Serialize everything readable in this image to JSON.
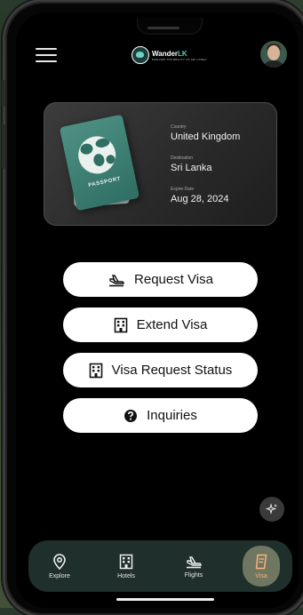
{
  "header": {
    "logo": {
      "name": "WanderLK",
      "name_a": "Wander",
      "name_b": "LK",
      "tagline": "EXPLORE THE BEAUTY OF SRI LANKA"
    }
  },
  "passport_card": {
    "cover_text": "PASSPORT",
    "fields": [
      {
        "label": "Country",
        "value": "United Kingdom"
      },
      {
        "label": "Destination",
        "value": "Sri Lanka"
      },
      {
        "label": "Expire Date",
        "value": "Aug 28, 2024"
      }
    ]
  },
  "actions": [
    {
      "label": "Request Visa",
      "icon": "plane-icon"
    },
    {
      "label": "Extend Visa",
      "icon": "building-icon"
    },
    {
      "label": "Visa Request Status",
      "icon": "building-icon"
    },
    {
      "label": "Inquiries",
      "icon": "question-icon"
    }
  ],
  "bottom_nav": [
    {
      "label": "Explore",
      "icon": "location-pin-icon",
      "active": false
    },
    {
      "label": "Hotels",
      "icon": "building-icon",
      "active": false
    },
    {
      "label": "Flights",
      "icon": "plane-icon",
      "active": false
    },
    {
      "label": "Visa",
      "icon": "document-icon",
      "active": true
    }
  ],
  "colors": {
    "nav_bg": "#1f2f2b",
    "active_tab": "#6f7661",
    "active_label": "#ffb27d",
    "brand_accent": "#5ad0c2"
  }
}
